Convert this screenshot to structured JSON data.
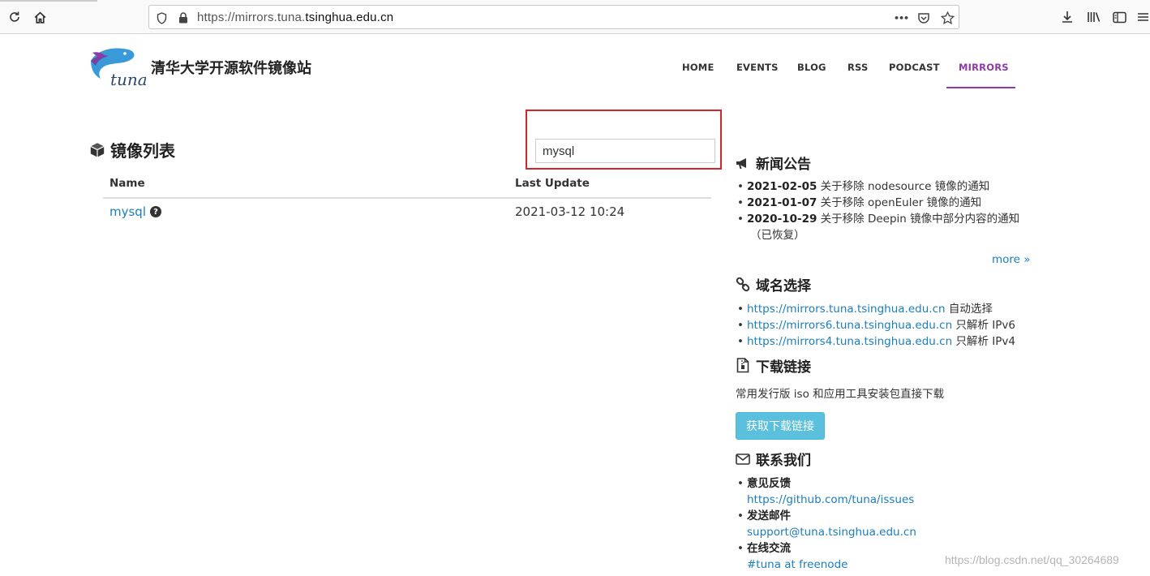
{
  "browser": {
    "url_prefix": "https://mirrors.tuna.",
    "url_host": "tsinghua.edu.cn",
    "url_more": "•••"
  },
  "site": {
    "title": "清华大学开源软件镜像站",
    "logo_text": "tuna",
    "nav": [
      "HOME",
      "EVENTS",
      "BLOG",
      "RSS",
      "PODCAST",
      "MIRRORS"
    ],
    "active_nav": "MIRRORS",
    "accent": "#8e3aa8"
  },
  "mirrors": {
    "heading": "镜像列表",
    "search_value": "mysql",
    "columns": [
      "Name",
      "Last Update"
    ],
    "rows": [
      {
        "name": "mysql",
        "last_update": "2021-03-12 10:24"
      }
    ]
  },
  "news": {
    "heading": "新闻公告",
    "items": [
      {
        "date": "2021-02-05",
        "text": "关于移除 nodesource 镜像的通知"
      },
      {
        "date": "2021-01-07",
        "text": "关于移除 openEuler 镜像的通知"
      },
      {
        "date": "2020-10-29",
        "text": "关于移除 Deepin 镜像中部分内容的通知"
      }
    ],
    "item3_wrap": "（已恢复）",
    "more": "more »"
  },
  "domains": {
    "heading": "域名选择",
    "items": [
      {
        "url": "https://mirrors.tuna.tsinghua.edu.cn",
        "note": "自动选择"
      },
      {
        "url": "https://mirrors6.tuna.tsinghua.edu.cn",
        "note": "只解析 IPv6"
      },
      {
        "url": "https://mirrors4.tuna.tsinghua.edu.cn",
        "note": "只解析 IPv4"
      }
    ]
  },
  "downloads": {
    "heading": "下载链接",
    "description": "常用发行版 iso 和应用工具安装包直接下载",
    "button": "获取下载链接"
  },
  "contact": {
    "heading": "联系我们",
    "items": [
      {
        "label": "意见反馈",
        "link": "https://github.com/tuna/issues"
      },
      {
        "label": "发送邮件",
        "link": "support@tuna.tsinghua.edu.cn"
      },
      {
        "label": "在线交流",
        "link": "#tuna at freenode"
      }
    ]
  },
  "watermark": "https://blog.csdn.net/qq_30264689"
}
